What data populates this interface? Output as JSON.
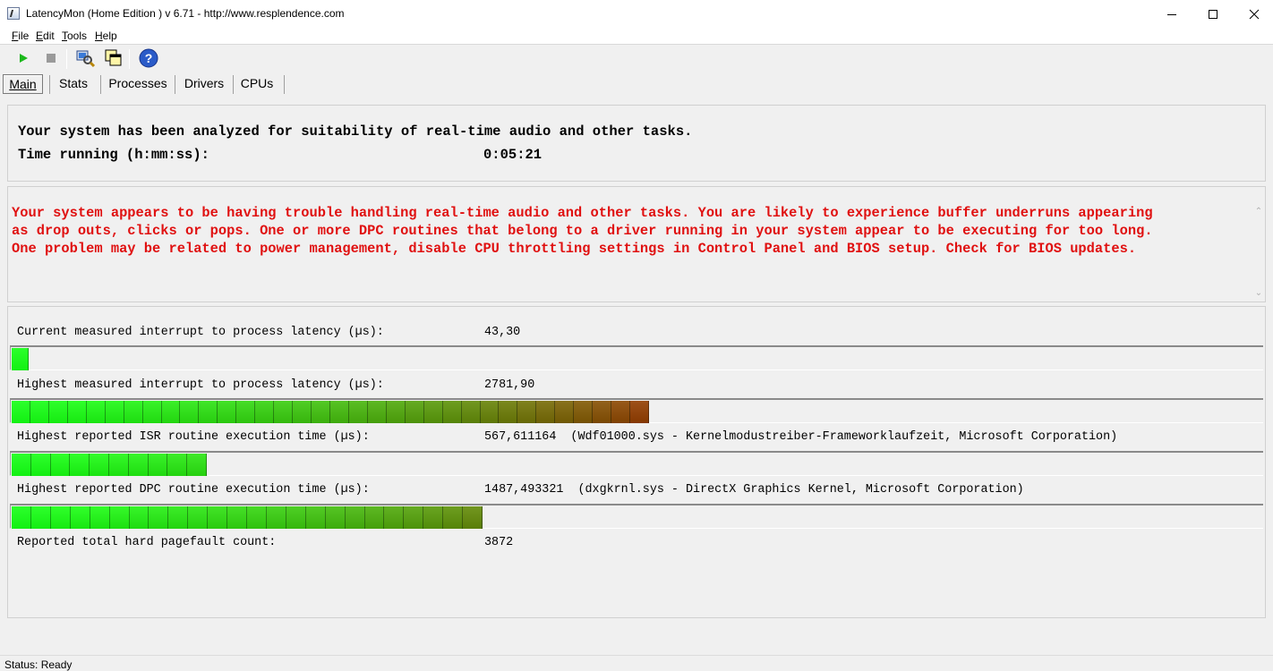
{
  "window": {
    "title": "LatencyMon  (Home Edition )  v 6.71 - http://www.resplendence.com",
    "minimize_label": "Minimize",
    "maximize_label": "Maximize",
    "close_label": "Close"
  },
  "menu": {
    "items": [
      {
        "key": "F",
        "rest": "ile"
      },
      {
        "key": "E",
        "rest": "dit"
      },
      {
        "key": "T",
        "rest": "ools"
      },
      {
        "key": "H",
        "rest": "elp"
      }
    ]
  },
  "toolbar": {
    "icons": [
      "play-icon",
      "stop-icon",
      "search-system-icon",
      "windows-icon",
      "help-icon"
    ]
  },
  "tabs": [
    "Main",
    "Stats",
    "Processes",
    "Drivers",
    "CPUs"
  ],
  "summary": {
    "analyzed_text": "Your system has been analyzed for suitability of real-time audio and other tasks.",
    "time_label": "Time running (h:mm:ss):",
    "time_value": "0:05:21"
  },
  "warning": {
    "text": "Your system appears to be having trouble handling real-time audio and other tasks. You are likely to experience buffer underruns appearing\nas drop outs, clicks or pops. One or more DPC routines that belong to a driver running in your system appear to be executing for too long.\nOne problem may be related to power management, disable CPU throttling settings in Control Panel and BIOS setup. Check for BIOS updates.",
    "color": "#e01010"
  },
  "metrics": [
    {
      "label": "Current measured interrupt to process latency (µs):",
      "value": "43,30",
      "bar_fraction": 0.0136,
      "segments": 1
    },
    {
      "label": "Highest measured interrupt to process latency (µs):",
      "value": "2781,90",
      "bar_fraction": 0.509,
      "segments": 34
    },
    {
      "label": "Highest reported ISR routine execution time (µs):",
      "value": "567,611164  (Wdf01000.sys - Kernelmodustreiber-Frameworklaufzeit, Microsoft Corporation)",
      "bar_fraction": 0.156,
      "segments": 10
    },
    {
      "label": "Highest reported DPC routine execution time (µs):",
      "value": "1487,493321  (dxgkrnl.sys - DirectX Graphics Kernel, Microsoft Corporation)",
      "bar_fraction": 0.376,
      "segments": 24
    }
  ],
  "pagefault": {
    "label": "Reported total hard pagefault count:",
    "value": "3872"
  },
  "status": {
    "text": "Status: Ready"
  },
  "colors": {
    "bar_start": "#13f013",
    "bar_end": "#8a3000"
  }
}
